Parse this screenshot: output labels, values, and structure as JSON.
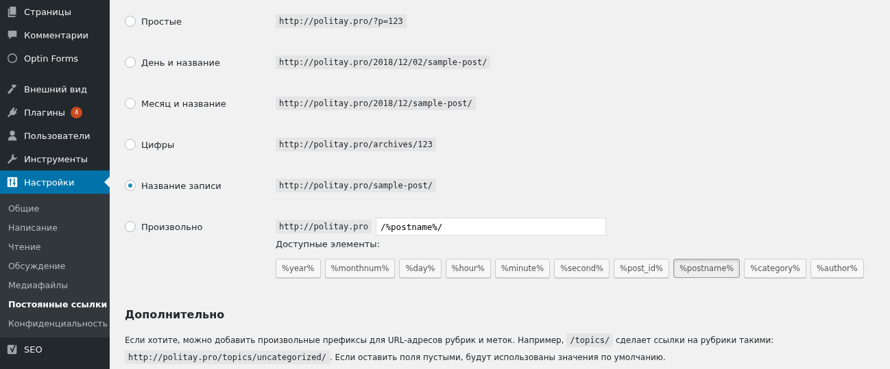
{
  "sidebar": {
    "items": [
      {
        "label": "Страницы",
        "kind": "pages",
        "selected": false
      },
      {
        "label": "Комментарии",
        "kind": "comments",
        "selected": false
      },
      {
        "label": "Optin Forms",
        "kind": "circle",
        "selected": false
      },
      {
        "label": "Внешний вид",
        "kind": "brush",
        "selected": false,
        "gap": true
      },
      {
        "label": "Плагины",
        "kind": "plug",
        "selected": false,
        "badge": "4"
      },
      {
        "label": "Пользователи",
        "kind": "user",
        "selected": false
      },
      {
        "label": "Инструменты",
        "kind": "wrench",
        "selected": false
      },
      {
        "label": "Настройки",
        "kind": "sliders",
        "selected": true,
        "submenu": [
          {
            "label": "Общие",
            "selected": false
          },
          {
            "label": "Написание",
            "selected": false
          },
          {
            "label": "Чтение",
            "selected": false
          },
          {
            "label": "Обсуждение",
            "selected": false
          },
          {
            "label": "Медиафайлы",
            "selected": false
          },
          {
            "label": "Постоянные ссылки",
            "selected": true
          },
          {
            "label": "Конфиденциальность",
            "selected": false
          }
        ]
      },
      {
        "label": "SEO",
        "kind": "seo",
        "selected": false
      }
    ]
  },
  "permalink_options": [
    {
      "label": "Простые",
      "selected": false,
      "example": "http://politay.pro/?p=123"
    },
    {
      "label": "День и название",
      "selected": false,
      "example": "http://politay.pro/2018/12/02/sample-post/"
    },
    {
      "label": "Месяц и название",
      "selected": false,
      "example": "http://politay.pro/2018/12/sample-post/"
    },
    {
      "label": "Цифры",
      "selected": false,
      "example": "http://politay.pro/archives/123"
    },
    {
      "label": "Название записи",
      "selected": true,
      "example": "http://politay.pro/sample-post/"
    },
    {
      "label": "Произвольно",
      "selected": false,
      "example": "http://politay.pro",
      "value": "/%postname%/"
    }
  ],
  "available_tags": {
    "label": "Доступные элементы:",
    "tags": [
      {
        "label": "%year%",
        "pressed": false
      },
      {
        "label": "%monthnum%",
        "pressed": false
      },
      {
        "label": "%day%",
        "pressed": false
      },
      {
        "label": "%hour%",
        "pressed": false
      },
      {
        "label": "%minute%",
        "pressed": false
      },
      {
        "label": "%second%",
        "pressed": false
      },
      {
        "label": "%post_id%",
        "pressed": false
      },
      {
        "label": "%postname%",
        "pressed": true
      },
      {
        "label": "%category%",
        "pressed": false
      },
      {
        "label": "%author%",
        "pressed": false
      }
    ]
  },
  "optional": {
    "heading": "Дополнительно",
    "description": [
      {
        "kind": "text",
        "text": "Если хотите, можно добавить произвольные префиксы для URL-адресов рубрик и меток. Например, "
      },
      {
        "kind": "code",
        "text": "/topics/"
      },
      {
        "kind": "text",
        "text": " сделает ссылки на рубрики такими: "
      },
      {
        "kind": "code",
        "text": "http://politay.pro/topics/uncategorized/"
      },
      {
        "kind": "text",
        "text": ". Если оставить поля пустыми, будут использованы значения по умолчанию."
      }
    ]
  }
}
